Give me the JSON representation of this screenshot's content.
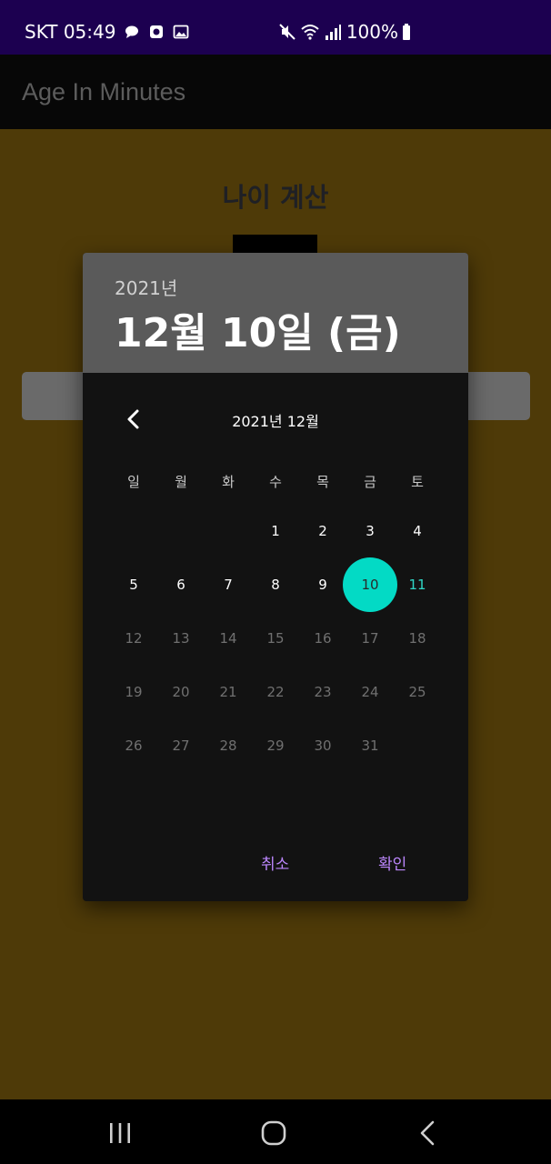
{
  "status_bar": {
    "carrier_time": "SKT 05:49",
    "battery": "100%",
    "left_icons": [
      "chat-bubble-icon",
      "app-notification-icon",
      "gallery-image-icon"
    ],
    "right_icons": [
      "mute-vibrate-icon",
      "wifi-icon",
      "signal-icon",
      "battery-icon"
    ]
  },
  "app_bar": {
    "title": "Age In Minutes"
  },
  "main": {
    "title": "나이 계산"
  },
  "dialog": {
    "header_year": "2021년",
    "header_date": "12월 10일 (금)",
    "month_label": "2021년 12월",
    "weekdays": [
      "일",
      "월",
      "화",
      "수",
      "목",
      "금",
      "토"
    ],
    "weeks": [
      [
        "",
        "",
        "",
        "1",
        "2",
        "3",
        "4"
      ],
      [
        "5",
        "6",
        "7",
        "8",
        "9",
        "10",
        "11"
      ],
      [
        "12",
        "13",
        "14",
        "15",
        "16",
        "17",
        "18"
      ],
      [
        "19",
        "20",
        "21",
        "22",
        "23",
        "24",
        "25"
      ],
      [
        "26",
        "27",
        "28",
        "29",
        "30",
        "31",
        ""
      ]
    ],
    "selected_day": "10",
    "today_day": "11",
    "last_enabled_day": 11,
    "cancel_label": "취소",
    "ok_label": "확인"
  },
  "colors": {
    "status_bar": "#1c0050",
    "background": "#4e3a08",
    "accent_selected": "#03dac5",
    "dialog_button": "#bb86fc"
  }
}
